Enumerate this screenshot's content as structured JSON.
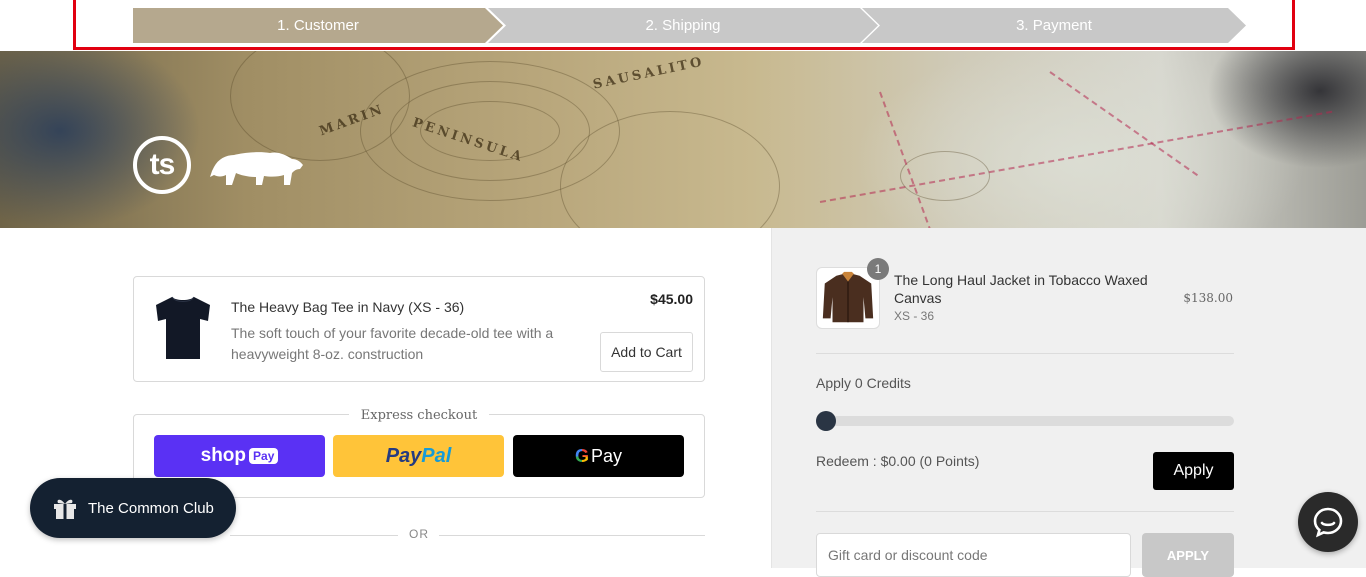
{
  "steps": [
    {
      "label": "1. Customer",
      "state": "active"
    },
    {
      "label": "2. Shipping",
      "state": "inactive"
    },
    {
      "label": "3. Payment",
      "state": "inactive"
    }
  ],
  "colors": {
    "step_active": "#b5a88e",
    "step_inactive": "#c8c8c8",
    "highlight_frame": "#e10010",
    "shop_pay": "#5a31f4",
    "paypal": "#ffc439",
    "club_bg": "#142131"
  },
  "banner": {
    "logo_text": "ts",
    "place_names": [
      "SAUSALITO",
      "MARIN",
      "PENINSULA"
    ]
  },
  "upsell": {
    "title": "The Heavy Bag Tee in Navy (XS - 36)",
    "description": "The soft touch of your favorite decade-old tee with a heavyweight 8-oz. construction",
    "price": "$45.00",
    "button_label": "Add to Cart",
    "image_icon": "tshirt-icon"
  },
  "express_checkout": {
    "label": "Express checkout",
    "shop_pay": {
      "text": "shop",
      "pill": "Pay"
    },
    "paypal": {
      "p1": "Pay",
      "p2": "Pal"
    },
    "gpay": {
      "g": "G",
      "text": "Pay"
    }
  },
  "or_label": "OR",
  "club_button": {
    "label": "The Common Club",
    "icon": "gift-icon"
  },
  "order_summary": {
    "item": {
      "title": "The Long Haul Jacket in Tobacco Waxed Canvas",
      "variant": "XS - 36",
      "price": "$138.00",
      "quantity": "1",
      "image_icon": "jacket-icon"
    },
    "credits_label": "Apply 0 Credits",
    "slider_value": 0,
    "redeem_label": "Redeem : $0.00 (0 Points)",
    "apply_label": "Apply",
    "discount": {
      "placeholder": "Gift card or discount code",
      "apply_label": "APPLY"
    }
  },
  "chat": {
    "icon": "chat-icon"
  }
}
